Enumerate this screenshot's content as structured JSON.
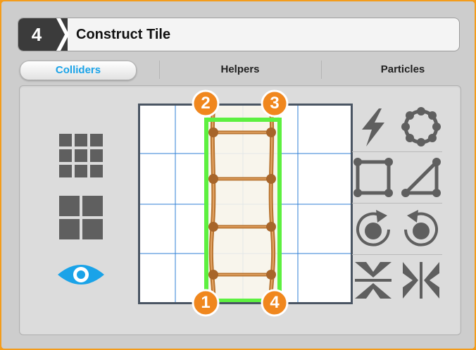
{
  "header": {
    "step_number": "4",
    "title": "Construct Tile"
  },
  "tabs": [
    {
      "label": "Colliders",
      "active": true
    },
    {
      "label": "Helpers",
      "active": false
    },
    {
      "label": "Particles",
      "active": false
    }
  ],
  "left_tools": [
    {
      "icon": "grid-3x3-icon"
    },
    {
      "icon": "grid-2x2-icon"
    },
    {
      "icon": "eye-icon",
      "active": true
    }
  ],
  "right_tools": [
    {
      "icon": "lightning-icon"
    },
    {
      "icon": "circle-collider-icon"
    },
    {
      "icon": "box-collider-icon"
    },
    {
      "icon": "triangle-collider-icon"
    },
    {
      "icon": "rotate-clockwise-icon"
    },
    {
      "icon": "rotate-counterclockwise-icon"
    },
    {
      "icon": "flip-vertical-icon"
    },
    {
      "icon": "flip-horizontal-icon"
    }
  ],
  "markers": [
    "1",
    "2",
    "3",
    "4"
  ],
  "colors": {
    "accent_blue": "#1aa3e8",
    "collider_green": "#5df040",
    "marker_orange": "#f0871e",
    "frame_orange": "#f39c1c",
    "icon_gray": "#5f5f5f"
  }
}
